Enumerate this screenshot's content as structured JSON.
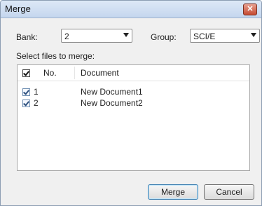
{
  "dialog": {
    "title": "Merge",
    "close_glyph": "✕"
  },
  "bank": {
    "label": "Bank:",
    "value": "2"
  },
  "group": {
    "label": "Group:",
    "value": "SCI/E"
  },
  "select_label": "Select files to merge:",
  "table": {
    "columns": [
      "No.",
      "Document"
    ],
    "rows": [
      {
        "no": "1",
        "document": "New Document1",
        "checked": true
      },
      {
        "no": "2",
        "document": "New Document2",
        "checked": true
      }
    ]
  },
  "buttons": {
    "merge": "Merge",
    "cancel": "Cancel"
  }
}
